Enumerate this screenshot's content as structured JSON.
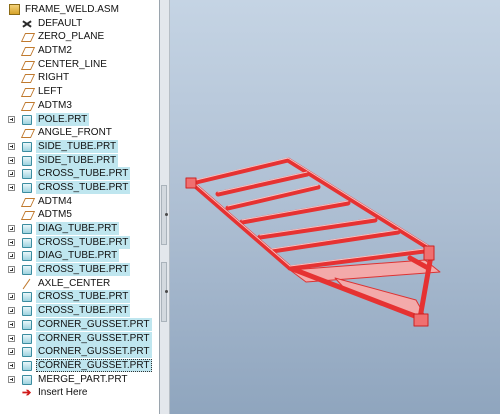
{
  "model_tree": {
    "items": [
      {
        "label": "FRAME_WELD.ASM",
        "icon": "assembly-icon",
        "expander": false,
        "selected": false,
        "root": true
      },
      {
        "label": "DEFAULT",
        "icon": "csys-icon",
        "expander": false,
        "selected": false
      },
      {
        "label": "ZERO_PLANE",
        "icon": "datum-plane-icon",
        "expander": false,
        "selected": false
      },
      {
        "label": "ADTM2",
        "icon": "datum-plane-icon",
        "expander": false,
        "selected": false
      },
      {
        "label": "CENTER_LINE",
        "icon": "datum-plane-icon",
        "expander": false,
        "selected": false
      },
      {
        "label": "RIGHT",
        "icon": "datum-plane-icon",
        "expander": false,
        "selected": false
      },
      {
        "label": "LEFT",
        "icon": "datum-plane-icon",
        "expander": false,
        "selected": false
      },
      {
        "label": "ADTM3",
        "icon": "datum-plane-icon",
        "expander": false,
        "selected": false
      },
      {
        "label": "POLE.PRT",
        "icon": "part-icon",
        "expander": true,
        "selected": true
      },
      {
        "label": "ANGLE_FRONT",
        "icon": "datum-plane-icon",
        "expander": false,
        "selected": false
      },
      {
        "label": "SIDE_TUBE.PRT",
        "icon": "part-icon",
        "expander": true,
        "selected": true
      },
      {
        "label": "SIDE_TUBE.PRT",
        "icon": "part-icon",
        "expander": true,
        "selected": true
      },
      {
        "label": "CROSS_TUBE.PRT",
        "icon": "part-icon",
        "expander": true,
        "selected": true
      },
      {
        "label": "CROSS_TUBE.PRT",
        "icon": "part-icon",
        "expander": true,
        "selected": true
      },
      {
        "label": "ADTM4",
        "icon": "datum-plane-icon",
        "expander": false,
        "selected": false
      },
      {
        "label": "ADTM5",
        "icon": "datum-plane-icon",
        "expander": false,
        "selected": false
      },
      {
        "label": "DIAG_TUBE.PRT",
        "icon": "part-icon",
        "expander": true,
        "selected": true
      },
      {
        "label": "CROSS_TUBE.PRT",
        "icon": "part-icon",
        "expander": true,
        "selected": true
      },
      {
        "label": "DIAG_TUBE.PRT",
        "icon": "part-icon",
        "expander": true,
        "selected": true
      },
      {
        "label": "CROSS_TUBE.PRT",
        "icon": "part-icon",
        "expander": true,
        "selected": true
      },
      {
        "label": "AXLE_CENTER",
        "icon": "datum-axis-icon",
        "expander": false,
        "selected": false
      },
      {
        "label": "CROSS_TUBE.PRT",
        "icon": "part-icon",
        "expander": true,
        "selected": true
      },
      {
        "label": "CROSS_TUBE.PRT",
        "icon": "part-icon",
        "expander": true,
        "selected": true
      },
      {
        "label": "CORNER_GUSSET.PRT",
        "icon": "part-icon",
        "expander": true,
        "selected": true
      },
      {
        "label": "CORNER_GUSSET.PRT",
        "icon": "part-icon",
        "expander": true,
        "selected": true
      },
      {
        "label": "CORNER_GUSSET.PRT",
        "icon": "part-icon",
        "expander": true,
        "selected": true
      },
      {
        "label": "CORNER_GUSSET.PRT",
        "icon": "part-icon",
        "expander": true,
        "selected": true,
        "focus": true
      },
      {
        "label": "MERGE_PART.PRT",
        "icon": "part-icon",
        "expander": true,
        "selected": false
      },
      {
        "label": "Insert Here",
        "icon": "insert-arrow-icon",
        "expander": false,
        "selected": false
      }
    ]
  },
  "viewport": {
    "background_top": "#c5d4e4",
    "background_bottom": "#8fa5be",
    "highlight_color": "#e83a3a",
    "model_icon": "trailer-frame-model"
  }
}
